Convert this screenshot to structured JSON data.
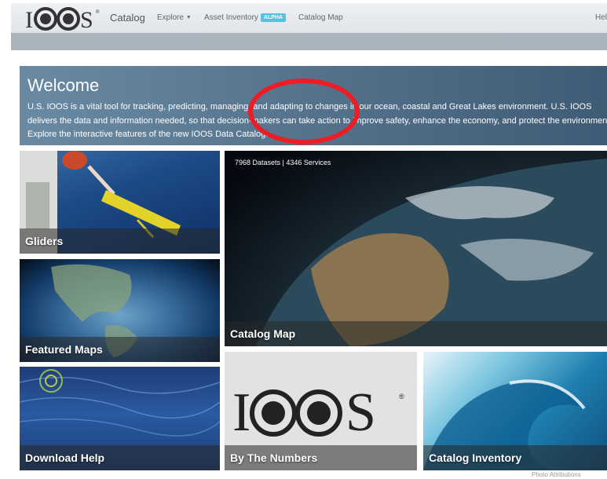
{
  "navbar": {
    "brand_text": "IOOS",
    "brand_suffix": "Catalog",
    "items": [
      {
        "label": "Explore",
        "icon": "caret-down-icon"
      },
      {
        "label": "Asset Inventory",
        "badge": "ALPHA"
      },
      {
        "label": "Catalog Map"
      },
      {
        "label": "Help"
      }
    ]
  },
  "welcome": {
    "title": "Welcome",
    "text": "U.S. IOOS is a vital tool for tracking, predicting, managing, and adapting to changes in our ocean, coastal and Great Lakes environment. U.S. IOOS delivers the data and information needed, so that decision-makers can take action to improve safety, enhance the economy, and protect the environment. Explore the interactive features of the new IOOS Data Catalog."
  },
  "tiles": {
    "gliders": "Gliders",
    "featured_maps": "Featured Maps",
    "download_help": "Download Help",
    "catalog_map": "Catalog Map",
    "catalog_map_stats": "7968 Datasets | 4346 Services",
    "by_the_numbers": "By The Numbers",
    "by_the_numbers_logo": "IOOS",
    "catalog_inventory": "Catalog Inventory"
  },
  "footer": {
    "attribution": "Photo Attributions"
  },
  "colors": {
    "navbar": "#e6eaee",
    "subbar": "#a9b4bd",
    "banner": "#55728c",
    "alpha_badge": "#5bc0de",
    "highlight_ring": "#ee1c24"
  }
}
